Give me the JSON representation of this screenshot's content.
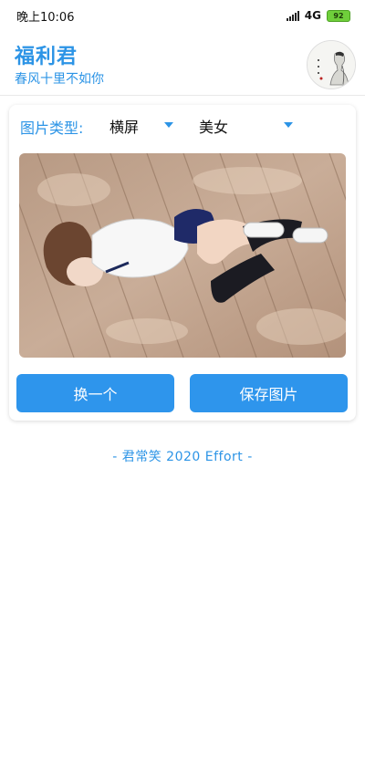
{
  "status_bar": {
    "time": "晚上10:06",
    "network": "4G",
    "battery": "92"
  },
  "header": {
    "title": "福利君",
    "subtitle": "春风十里不如你",
    "avatar_icon": "ink-portrait-avatar"
  },
  "card": {
    "type_label": "图片类型:",
    "orientation_dropdown": {
      "value": "横屏"
    },
    "category_dropdown": {
      "value": "美女"
    },
    "photo_icon": "photo-girl-on-wooden-deck",
    "change_button": "换一个",
    "save_button": "保存图片"
  },
  "footer": {
    "text": "- 君常笑 2020 Effort -"
  },
  "colors": {
    "accent": "#2c94e6",
    "button": "#2e95ec"
  }
}
